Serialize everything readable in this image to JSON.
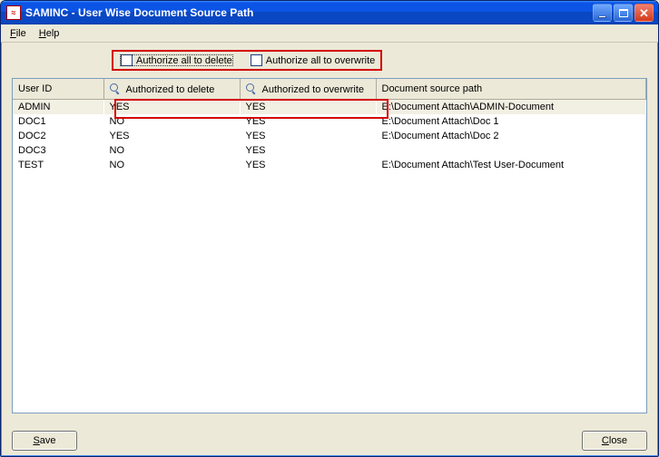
{
  "window": {
    "title": "SAMINC - User Wise Document Source Path"
  },
  "menu": {
    "file_u": "F",
    "file_rest": "ile",
    "help_u": "H",
    "help_rest": "elp"
  },
  "options": {
    "authorize_all_delete": "Authorize all to delete",
    "authorize_all_overwrite": "Authorize all to overwrite"
  },
  "grid": {
    "headers": {
      "user": "User ID",
      "auth_delete": "Authorized to delete",
      "auth_overwrite": "Authorized to overwrite",
      "path": "Document source path"
    },
    "rows": [
      {
        "user": "ADMIN",
        "del": "YES",
        "ovr": "YES",
        "path": "E:\\Document Attach\\ADMIN-Document"
      },
      {
        "user": "DOC1",
        "del": "NO",
        "ovr": "YES",
        "path": "E:\\Document Attach\\Doc 1"
      },
      {
        "user": "DOC2",
        "del": "YES",
        "ovr": "YES",
        "path": "E:\\Document Attach\\Doc 2"
      },
      {
        "user": "DOC3",
        "del": "NO",
        "ovr": "YES",
        "path": ""
      },
      {
        "user": "TEST",
        "del": "NO",
        "ovr": "YES",
        "path": "E:\\Document Attach\\Test User-Document"
      }
    ]
  },
  "buttons": {
    "save_u": "S",
    "save_rest": "ave",
    "close_u": "C",
    "close_rest": "lose"
  },
  "colors": {
    "highlight_red": "#d40000",
    "titlebar_blue": "#0b54e6",
    "ui_bg": "#ece9d8"
  }
}
